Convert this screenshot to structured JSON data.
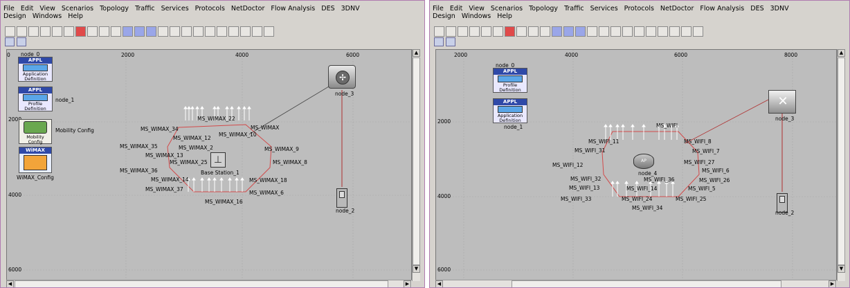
{
  "menu": {
    "row1": [
      "File",
      "Edit",
      "View",
      "Scenarios",
      "Topology",
      "Traffic",
      "Services",
      "Protocols",
      "NetDoctor",
      "Flow Analysis",
      "DES",
      "3DNV"
    ],
    "row2": [
      "Design",
      "Windows",
      "Help"
    ]
  },
  "icons": {
    "toolbar": [
      "new-icon",
      "open-icon",
      "save-icon",
      "print-icon",
      "select-icon",
      "stop-icon",
      "record-icon",
      "object-palette-icon",
      "zoom-in-icon",
      "zoom-out-icon",
      "import-icon",
      "config-icon",
      "deploy-icon",
      "stats-icon",
      "results-icon",
      "graph-icon",
      "link-icon",
      "node-icon",
      "route-icon",
      "analysis-icon",
      "table-icon",
      "window-icon",
      "help-icon"
    ],
    "toolbar2": [
      "map-icon",
      "java-icon"
    ]
  },
  "left": {
    "x_ticks": [
      "0",
      "2000",
      "4000",
      "6000"
    ],
    "y_ticks": [
      "2000",
      "4000",
      "6000"
    ],
    "node_0": "node_0",
    "appl_header": "APPL",
    "appl_def_text": "Application Definition",
    "profile_def_text": "Profile Definition",
    "node_1": "node_1",
    "mobility_text": "Mobility Config",
    "mobility_label": "Mobility Config",
    "wimax_header": "WiMAX",
    "wimax_label": "WiMAX_Config",
    "node_3": "node_3",
    "node_2": "node_2",
    "base_station": "Base Station_1",
    "stations": [
      "MS_WIMAX_22",
      "MS_WIMAX_34",
      "MS_WIMAX",
      "MS_WIMAX_12",
      "MS_WIMAX_10",
      "MS_WIMAX_35",
      "MS_WIMAX_2",
      "MS_WIMAX_9",
      "MS_WIMAX_13",
      "MS_WIMAX_25",
      "MS_WIMAX_8",
      "MS_WIMAX_36",
      "MS_WIMAX_14",
      "MS_WIMAX_18",
      "MS_WIMAX_37",
      "MS_WIMAX_6",
      "MS_WIMAX_16"
    ]
  },
  "right": {
    "x_ticks": [
      "2000",
      "4000",
      "6000",
      "8000"
    ],
    "y_ticks": [
      "2000",
      "4000",
      "6000"
    ],
    "node_0": "node_0",
    "appl_header": "APPL",
    "profile_def_text": "Profile Definition",
    "appl_def_text": "Application Definition",
    "node_1": "node_1",
    "node_3": "node_3",
    "node_2": "node_2",
    "node_4": "node_4",
    "ap_label": "AP",
    "stations": [
      "MS_WIFI",
      "MS_WIFI_11",
      "MS_WIFI_8",
      "MS_WIFI_31",
      "MS_WIFI_7",
      "MS_WIFI_27",
      "MS_WIFI_12",
      "MS_WIFI_6",
      "MS_WIFI_32",
      "MS_WIFI_36",
      "MS_WIFI_26",
      "MS_WIFI_13",
      "MS_WIFI_14",
      "MS_WIFI_5",
      "MS_WIFI_33",
      "MS_WIFI_24",
      "MS_WIFI_25",
      "MS_WIFI_34"
    ]
  }
}
